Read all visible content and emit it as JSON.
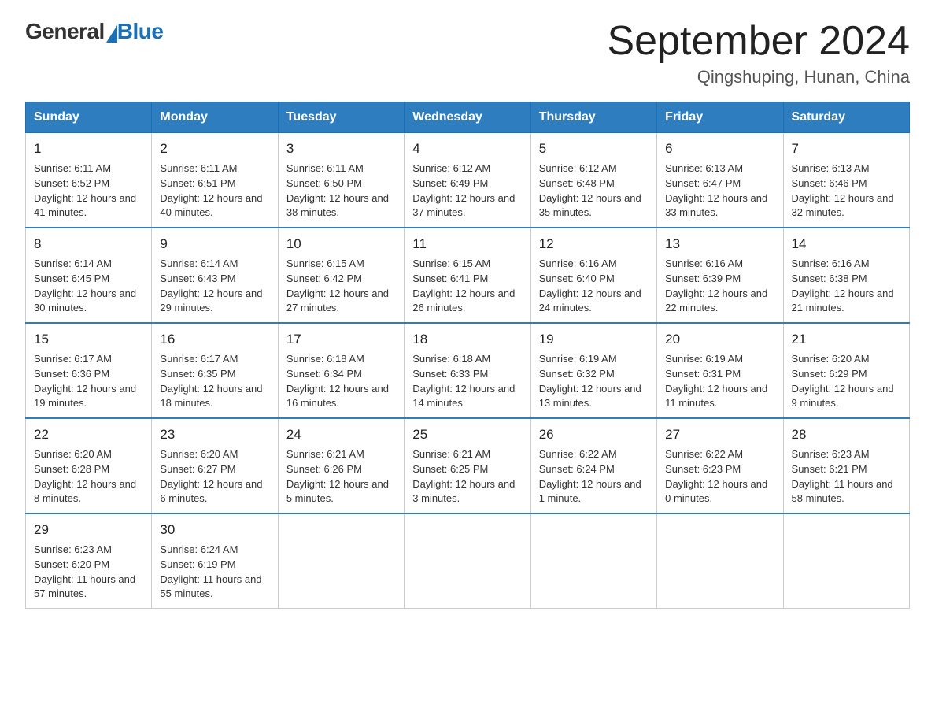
{
  "logo": {
    "general_text": "General",
    "blue_text": "Blue"
  },
  "title": "September 2024",
  "subtitle": "Qingshuping, Hunan, China",
  "days_of_week": [
    "Sunday",
    "Monday",
    "Tuesday",
    "Wednesday",
    "Thursday",
    "Friday",
    "Saturday"
  ],
  "weeks": [
    [
      {
        "day": "1",
        "sunrise": "6:11 AM",
        "sunset": "6:52 PM",
        "daylight": "12 hours and 41 minutes."
      },
      {
        "day": "2",
        "sunrise": "6:11 AM",
        "sunset": "6:51 PM",
        "daylight": "12 hours and 40 minutes."
      },
      {
        "day": "3",
        "sunrise": "6:11 AM",
        "sunset": "6:50 PM",
        "daylight": "12 hours and 38 minutes."
      },
      {
        "day": "4",
        "sunrise": "6:12 AM",
        "sunset": "6:49 PM",
        "daylight": "12 hours and 37 minutes."
      },
      {
        "day": "5",
        "sunrise": "6:12 AM",
        "sunset": "6:48 PM",
        "daylight": "12 hours and 35 minutes."
      },
      {
        "day": "6",
        "sunrise": "6:13 AM",
        "sunset": "6:47 PM",
        "daylight": "12 hours and 33 minutes."
      },
      {
        "day": "7",
        "sunrise": "6:13 AM",
        "sunset": "6:46 PM",
        "daylight": "12 hours and 32 minutes."
      }
    ],
    [
      {
        "day": "8",
        "sunrise": "6:14 AM",
        "sunset": "6:45 PM",
        "daylight": "12 hours and 30 minutes."
      },
      {
        "day": "9",
        "sunrise": "6:14 AM",
        "sunset": "6:43 PM",
        "daylight": "12 hours and 29 minutes."
      },
      {
        "day": "10",
        "sunrise": "6:15 AM",
        "sunset": "6:42 PM",
        "daylight": "12 hours and 27 minutes."
      },
      {
        "day": "11",
        "sunrise": "6:15 AM",
        "sunset": "6:41 PM",
        "daylight": "12 hours and 26 minutes."
      },
      {
        "day": "12",
        "sunrise": "6:16 AM",
        "sunset": "6:40 PM",
        "daylight": "12 hours and 24 minutes."
      },
      {
        "day": "13",
        "sunrise": "6:16 AM",
        "sunset": "6:39 PM",
        "daylight": "12 hours and 22 minutes."
      },
      {
        "day": "14",
        "sunrise": "6:16 AM",
        "sunset": "6:38 PM",
        "daylight": "12 hours and 21 minutes."
      }
    ],
    [
      {
        "day": "15",
        "sunrise": "6:17 AM",
        "sunset": "6:36 PM",
        "daylight": "12 hours and 19 minutes."
      },
      {
        "day": "16",
        "sunrise": "6:17 AM",
        "sunset": "6:35 PM",
        "daylight": "12 hours and 18 minutes."
      },
      {
        "day": "17",
        "sunrise": "6:18 AM",
        "sunset": "6:34 PM",
        "daylight": "12 hours and 16 minutes."
      },
      {
        "day": "18",
        "sunrise": "6:18 AM",
        "sunset": "6:33 PM",
        "daylight": "12 hours and 14 minutes."
      },
      {
        "day": "19",
        "sunrise": "6:19 AM",
        "sunset": "6:32 PM",
        "daylight": "12 hours and 13 minutes."
      },
      {
        "day": "20",
        "sunrise": "6:19 AM",
        "sunset": "6:31 PM",
        "daylight": "12 hours and 11 minutes."
      },
      {
        "day": "21",
        "sunrise": "6:20 AM",
        "sunset": "6:29 PM",
        "daylight": "12 hours and 9 minutes."
      }
    ],
    [
      {
        "day": "22",
        "sunrise": "6:20 AM",
        "sunset": "6:28 PM",
        "daylight": "12 hours and 8 minutes."
      },
      {
        "day": "23",
        "sunrise": "6:20 AM",
        "sunset": "6:27 PM",
        "daylight": "12 hours and 6 minutes."
      },
      {
        "day": "24",
        "sunrise": "6:21 AM",
        "sunset": "6:26 PM",
        "daylight": "12 hours and 5 minutes."
      },
      {
        "day": "25",
        "sunrise": "6:21 AM",
        "sunset": "6:25 PM",
        "daylight": "12 hours and 3 minutes."
      },
      {
        "day": "26",
        "sunrise": "6:22 AM",
        "sunset": "6:24 PM",
        "daylight": "12 hours and 1 minute."
      },
      {
        "day": "27",
        "sunrise": "6:22 AM",
        "sunset": "6:23 PM",
        "daylight": "12 hours and 0 minutes."
      },
      {
        "day": "28",
        "sunrise": "6:23 AM",
        "sunset": "6:21 PM",
        "daylight": "11 hours and 58 minutes."
      }
    ],
    [
      {
        "day": "29",
        "sunrise": "6:23 AM",
        "sunset": "6:20 PM",
        "daylight": "11 hours and 57 minutes."
      },
      {
        "day": "30",
        "sunrise": "6:24 AM",
        "sunset": "6:19 PM",
        "daylight": "11 hours and 55 minutes."
      },
      null,
      null,
      null,
      null,
      null
    ]
  ]
}
